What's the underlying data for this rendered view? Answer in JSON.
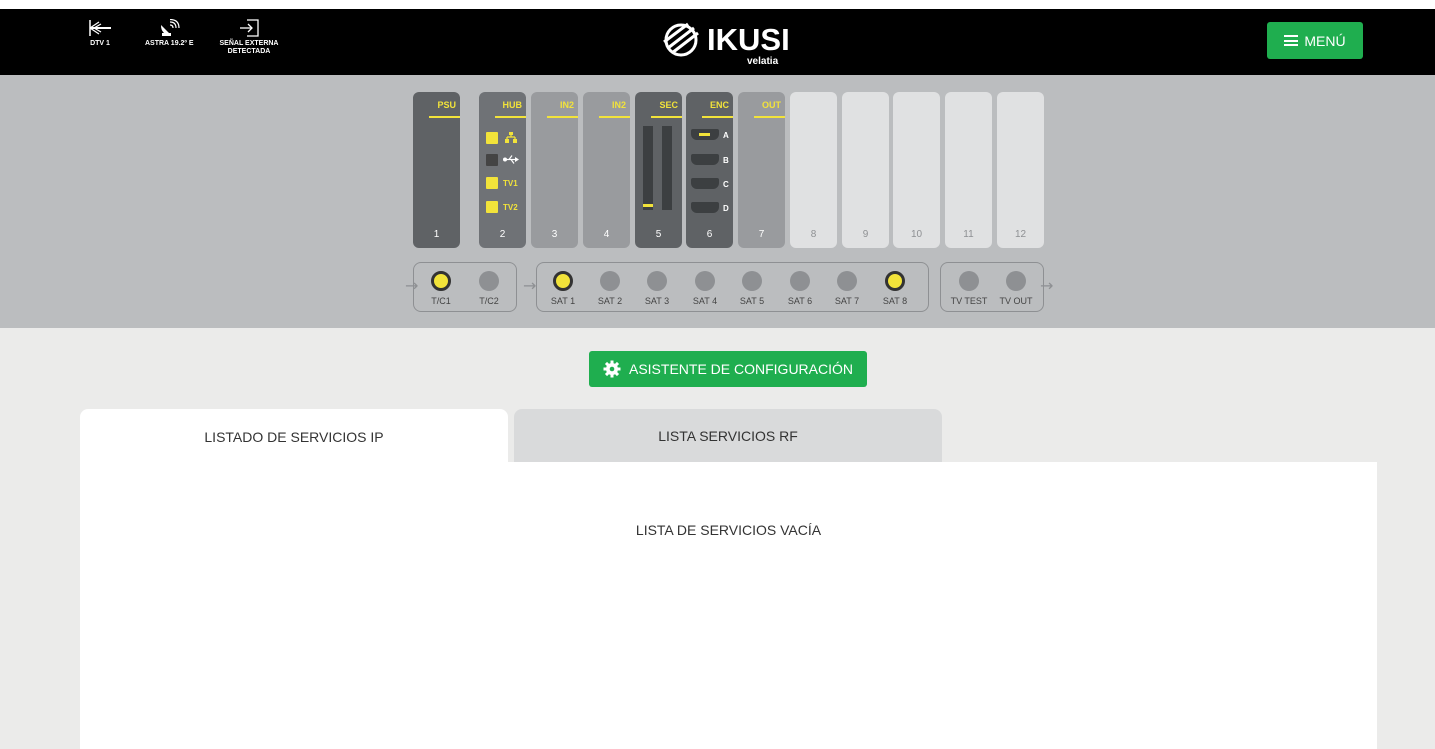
{
  "header": {
    "status": [
      {
        "label": "DTV 1",
        "icon": "antenna-icon"
      },
      {
        "label": "ASTRA 19.2º E",
        "icon": "satellite-dish-icon"
      },
      {
        "label": "SEÑAL EXTERNA DETECTADA",
        "icon": "external-input-icon"
      }
    ],
    "logo": {
      "name": "IKUSI",
      "sub": "velatia"
    },
    "menu_label": "MENÚ"
  },
  "rack": {
    "slots": [
      {
        "label": "PSU",
        "number": "1",
        "state": "dark"
      },
      {
        "label": "HUB",
        "number": "2",
        "state": "mid"
      },
      {
        "label": "IN2",
        "number": "3",
        "state": "light"
      },
      {
        "label": "IN2",
        "number": "4",
        "state": "light"
      },
      {
        "label": "SEC",
        "number": "5",
        "state": "dark"
      },
      {
        "label": "ENC",
        "number": "6",
        "state": "dark"
      },
      {
        "label": "OUT",
        "number": "7",
        "state": "light"
      },
      {
        "label": "",
        "number": "8",
        "state": "empty"
      },
      {
        "label": "",
        "number": "9",
        "state": "empty"
      },
      {
        "label": "",
        "number": "10",
        "state": "empty"
      },
      {
        "label": "",
        "number": "11",
        "state": "empty"
      },
      {
        "label": "",
        "number": "12",
        "state": "empty"
      }
    ],
    "hub_ports": [
      {
        "label": "",
        "icon": "network-icon",
        "active": true
      },
      {
        "label": "",
        "icon": "usb-icon",
        "active": false
      },
      {
        "label": "TV1",
        "active": true
      },
      {
        "label": "TV2",
        "active": true
      }
    ],
    "enc_ports": [
      "A",
      "B",
      "C",
      "D"
    ],
    "inputs_terrestrial": [
      {
        "label": "T/C1",
        "on": true
      },
      {
        "label": "T/C2",
        "on": false
      }
    ],
    "inputs_sat": [
      {
        "label": "SAT 1",
        "on": true
      },
      {
        "label": "SAT 2",
        "on": false
      },
      {
        "label": "SAT 3",
        "on": false
      },
      {
        "label": "SAT 4",
        "on": false
      },
      {
        "label": "SAT 5",
        "on": false
      },
      {
        "label": "SAT 6",
        "on": false
      },
      {
        "label": "SAT 7",
        "on": false
      },
      {
        "label": "SAT 8",
        "on": true
      }
    ],
    "outputs": [
      {
        "label": "TV TEST",
        "on": false
      },
      {
        "label": "TV OUT",
        "on": false
      }
    ]
  },
  "wizard_label": "ASISTENTE DE CONFIGURACIÓN",
  "tabs": [
    {
      "label": "LISTADO DE SERVICIOS IP",
      "active": true
    },
    {
      "label": "LISTA SERVICIOS RF",
      "active": false
    }
  ],
  "empty_message": "LISTA DE SERVICIOS VACÍA",
  "colors": {
    "accent": "#1fae4f",
    "led_on": "#f2e33a",
    "header_bg": "#000000",
    "rack_bg": "#bbbdbf"
  }
}
